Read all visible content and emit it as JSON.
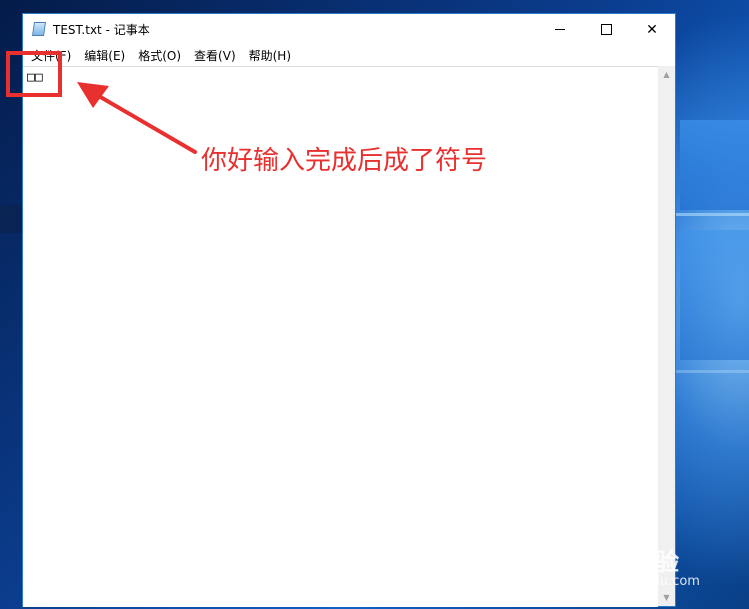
{
  "window": {
    "title": "TEST.txt - 记事本",
    "menu": [
      {
        "label": "文件(F)"
      },
      {
        "label": "编辑(E)"
      },
      {
        "label": "格式(O)"
      },
      {
        "label": "查看(V)"
      },
      {
        "label": "帮助(H)"
      }
    ],
    "content": "□□",
    "controls": {
      "close_glyph": "✕"
    }
  },
  "annotation": {
    "text": "你好输入完成后成了符号",
    "color": "#e8302f"
  },
  "watermark": {
    "logo": "Bai 经验",
    "sub": "jingyan.baidu.com"
  },
  "icons": [
    "notepad-icon",
    "minimize-icon",
    "maximize-icon",
    "close-icon",
    "scroll-up-icon",
    "scroll-down-icon"
  ]
}
